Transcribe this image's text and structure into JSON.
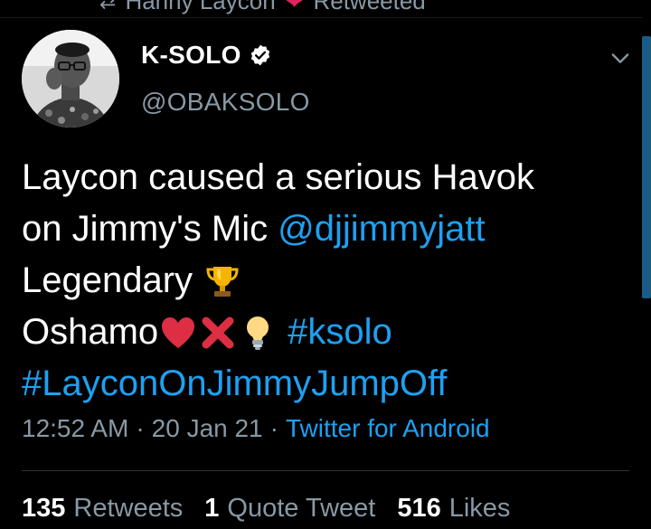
{
  "retweet_context": {
    "text": "Hanny Laycon",
    "suffix": "Retweeted"
  },
  "author": {
    "display_name": "K-SOLO",
    "handle": "@OBAKSOLO",
    "verified": true
  },
  "tweet": {
    "line1": "Laycon caused a serious Havok",
    "line2_text": "on Jimmy's Mic",
    "line2_mention": "@djjimmyjatt",
    "line3_text": "Legendary",
    "line4_text": "Oshamo",
    "line4_hashtag": "#ksolo",
    "line5_hashtag": "#LayconOnJimmyJumpOff"
  },
  "meta": {
    "time": "12:52 AM",
    "separator": "·",
    "date": "20 Jan 21",
    "source": "Twitter for Android"
  },
  "stats": {
    "retweets_count": "135",
    "retweets_label": "Retweets",
    "quotes_count": "1",
    "quotes_label": "Quote Tweet",
    "likes_count": "516",
    "likes_label": "Likes"
  },
  "colors": {
    "background": "#000000",
    "link": "#1da1f2",
    "secondary_text": "#8899a6",
    "divider": "#2f3336"
  },
  "icons": [
    "retweet-icon",
    "verified-badge-icon",
    "chevron-down-icon",
    "trophy-emoji",
    "red-heart-emoji",
    "cross-mark-emoji",
    "light-bulb-emoji"
  ]
}
